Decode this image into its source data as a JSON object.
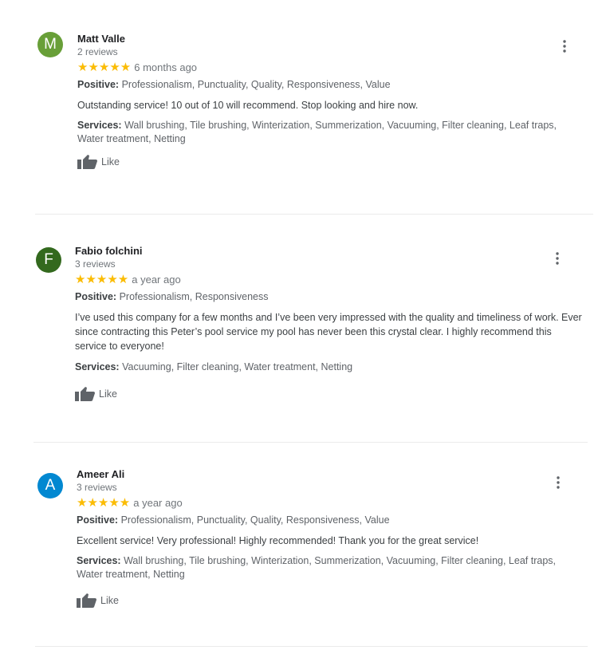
{
  "reviews": [
    {
      "initial": "M",
      "avatar_color": "#689f38",
      "name": "Matt Valle",
      "reviews_count": "2 reviews",
      "stars": "★★★★★",
      "time": "6 months ago",
      "positive_label": "Positive:",
      "positive_text": " Professionalism, Punctuality, Quality, Responsiveness, Value",
      "text": "Outstanding service! 10 out of 10 will recommend. Stop looking and hire now.",
      "services_label": "Services:",
      "services_text": " Wall brushing, Tile brushing, Winterization, Summerization, Vacuuming, Filter cleaning, Leaf traps, Water treatment, Netting",
      "like_label": "Like"
    },
    {
      "initial": "F",
      "avatar_color": "#33691e",
      "name": "Fabio folchini",
      "reviews_count": "3 reviews",
      "stars": "★★★★★",
      "time": "a year ago",
      "positive_label": "Positive:",
      "positive_text": " Professionalism, Responsiveness",
      "text": "I’ve used this company for a few months and I’ve been very impressed with the quality and timeliness of work. Ever since contracting this Peter’s pool service my pool has never been this crystal clear. I highly recommend this service to everyone!",
      "services_label": "Services:",
      "services_text": " Vacuuming, Filter cleaning, Water treatment, Netting",
      "like_label": "Like"
    },
    {
      "initial": "A",
      "avatar_color": "#0288d1",
      "name": "Ameer Ali",
      "reviews_count": "3 reviews",
      "stars": "★★★★★",
      "time": "a year ago",
      "positive_label": "Positive:",
      "positive_text": " Professionalism, Punctuality, Quality, Responsiveness, Value",
      "text": "Excellent service!  Very professional!  Highly recommended!  Thank you for the great service!",
      "services_label": "Services:",
      "services_text": " Wall brushing, Tile brushing, Winterization, Summerization, Vacuuming, Filter cleaning, Leaf traps, Water treatment, Netting",
      "like_label": "Like"
    }
  ],
  "icons": {
    "menu": "more-vert-icon",
    "like": "thumb-up-icon"
  }
}
